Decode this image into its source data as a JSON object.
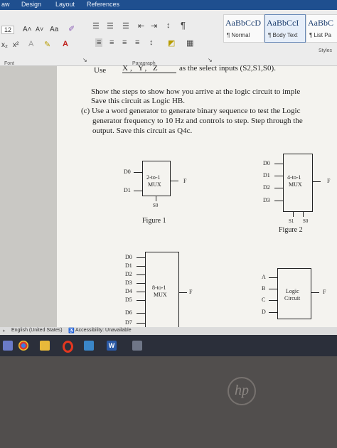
{
  "ribbon": {
    "tabs": [
      "aw",
      "Design",
      "Layout",
      "References"
    ],
    "font_size": "12",
    "grow_font": "A˄",
    "shrink_font": "A˅",
    "change_case": "Aa",
    "subscript": "x₂",
    "superscript": "x²",
    "font_group_label": "Font",
    "paragraph_group_label": "Paragraph",
    "styles_label": "Styles",
    "styles": [
      {
        "sample": "AaBbCcD",
        "name": "¶ Normal"
      },
      {
        "sample": "AaBbCcI",
        "name": "¶ Body Text"
      },
      {
        "sample": "AaBbC",
        "name": "¶ List Pa"
      }
    ]
  },
  "document": {
    "line_use": "Use",
    "line_vars": "X, Y, Z",
    "line_rest": "as the select inputs (S2,S1,S0).",
    "line2": "Show the steps to show how you arrive at the logic circuit to imple",
    "line3": "Save this circuit as Logic HB.",
    "line4": "(c) Use a word generator to generate binary sequence to test the Logic",
    "line5": "generator frequency to 10 Hz and controls to step. Step through the",
    "line6": "output. Save this circuit as Q4c.",
    "fig1": {
      "d0": "D0",
      "d1": "D1",
      "title": "2-to-1",
      "sub": "MUX",
      "out": "F",
      "sel": "S0",
      "caption": "Figure 1"
    },
    "fig2": {
      "inputs": [
        "D0",
        "D1",
        "D2",
        "D3"
      ],
      "title": "4-to-1",
      "sub": "MUX",
      "out": "F",
      "s1": "S1",
      "s0": "S0",
      "caption": "Figure 2"
    },
    "fig3": {
      "inputs": [
        "D0",
        "D1",
        "D2",
        "D3",
        "D4",
        "D5",
        "D6",
        "D7"
      ],
      "title": "8-to-1",
      "sub": "MUX",
      "out": "F"
    },
    "fig4": {
      "inputs": [
        "A",
        "B",
        "C",
        "D"
      ],
      "title": "Logic",
      "sub": "Circuit",
      "out": "F"
    }
  },
  "statusbar": {
    "language": "English (United States)",
    "accessibility": "Accessibility: Unavailable"
  },
  "taskbar": {
    "icons": [
      "start-icon",
      "chrome-icon",
      "file-explorer-icon",
      "opera-icon",
      "photos-icon",
      "word-icon",
      "calculator-icon"
    ]
  },
  "laptop": {
    "logo": "hp"
  }
}
